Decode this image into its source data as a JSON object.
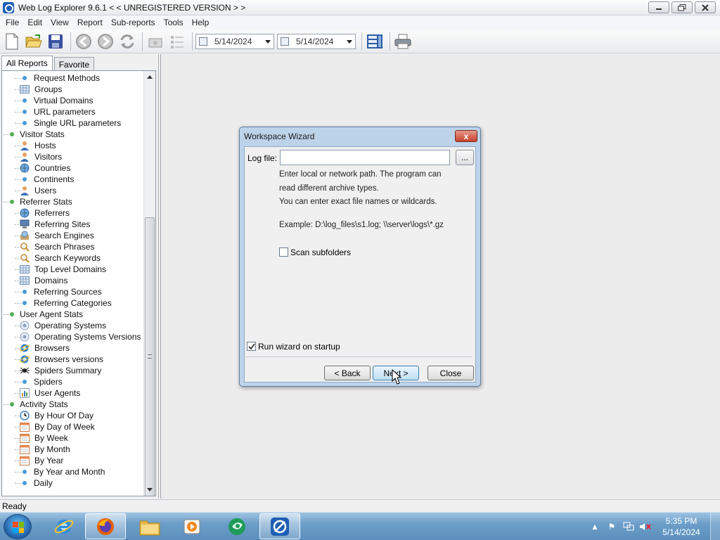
{
  "window": {
    "title": "Web Log Explorer 9.6.1  < < UNREGISTERED VERSION > >",
    "controls": [
      "minimize",
      "restore",
      "close"
    ]
  },
  "menu": [
    "File",
    "Edit",
    "View",
    "Report",
    "Sub-reports",
    "Tools",
    "Help"
  ],
  "toolbar": {
    "date_from": "5/14/2024",
    "date_to": "5/14/2024"
  },
  "left_panel": {
    "tabs": [
      "All Reports",
      "Favorite"
    ],
    "active_tab": "All Reports",
    "tree": [
      {
        "label": "Request Methods",
        "level": 1,
        "icon": "dot"
      },
      {
        "label": "Groups",
        "level": 1,
        "icon": "grid-icon"
      },
      {
        "label": "Virtual Domains",
        "level": 1,
        "icon": "dot"
      },
      {
        "label": "URL parameters",
        "level": 1,
        "icon": "dot"
      },
      {
        "label": "Single URL parameters",
        "level": 1,
        "icon": "dot"
      },
      {
        "label": "Visitor Stats",
        "level": 0,
        "icon": "dot-green"
      },
      {
        "label": "Hosts",
        "level": 1,
        "icon": "person-icon"
      },
      {
        "label": "Visitors",
        "level": 1,
        "icon": "person-icon"
      },
      {
        "label": "Countries",
        "level": 1,
        "icon": "globe-icon"
      },
      {
        "label": "Continents",
        "level": 1,
        "icon": "dot"
      },
      {
        "label": "Users",
        "level": 1,
        "icon": "person-icon"
      },
      {
        "label": "Referrer Stats",
        "level": 0,
        "icon": "dot-green"
      },
      {
        "label": "Referrers",
        "level": 1,
        "icon": "globe-icon"
      },
      {
        "label": "Referring Sites",
        "level": 1,
        "icon": "computer-icon"
      },
      {
        "label": "Search Engines",
        "level": 1,
        "icon": "search-engine-icon"
      },
      {
        "label": "Search Phrases",
        "level": 1,
        "icon": "magnifier-icon"
      },
      {
        "label": "Search Keywords",
        "level": 1,
        "icon": "magnifier-icon"
      },
      {
        "label": "Top Level Domains",
        "level": 1,
        "icon": "grid-icon"
      },
      {
        "label": "Domains",
        "level": 1,
        "icon": "grid-icon"
      },
      {
        "label": "Referring Sources",
        "level": 1,
        "icon": "dot"
      },
      {
        "label": "Referring Categories",
        "level": 1,
        "icon": "dot"
      },
      {
        "label": "User Agent Stats",
        "level": 0,
        "icon": "dot-green"
      },
      {
        "label": "Operating Systems",
        "level": 1,
        "icon": "os-icon"
      },
      {
        "label": "Operating Systems Versions",
        "level": 1,
        "icon": "os-icon"
      },
      {
        "label": "Browsers",
        "level": 1,
        "icon": "ie-icon"
      },
      {
        "label": "Browsers versions",
        "level": 1,
        "icon": "ie-icon"
      },
      {
        "label": "Spiders Summary",
        "level": 1,
        "icon": "spider-icon"
      },
      {
        "label": "Spiders",
        "level": 1,
        "icon": "dot"
      },
      {
        "label": "User Agents",
        "level": 1,
        "icon": "chart-icon"
      },
      {
        "label": "Activity Stats",
        "level": 0,
        "icon": "dot-green"
      },
      {
        "label": "By Hour Of Day",
        "level": 1,
        "icon": "clock-icon"
      },
      {
        "label": "By Day of Week",
        "level": 1,
        "icon": "calendar-icon"
      },
      {
        "label": "By Week",
        "level": 1,
        "icon": "calendar-icon"
      },
      {
        "label": "By Month",
        "level": 1,
        "icon": "calendar-icon"
      },
      {
        "label": "By Year",
        "level": 1,
        "icon": "calendar-icon"
      },
      {
        "label": "By Year and Month",
        "level": 1,
        "icon": "dot"
      },
      {
        "label": "Daily",
        "level": 1,
        "icon": "dot"
      }
    ]
  },
  "dialog": {
    "title": "Workspace Wizard",
    "close_label": "x",
    "logfile_label": "Log file:",
    "logfile_value": "",
    "browse_label": "...",
    "help_line1": "Enter local or network path. The program can",
    "help_line2": "read different archive types.",
    "help_line3": "You can enter exact file names or wildcards.",
    "example": "Example: D:\\log_files\\s1.log; \\\\server\\logs\\*.gz",
    "scan_subfolders_label": "Scan subfolders",
    "scan_subfolders_checked": false,
    "run_wizard_label": "Run wizard on startup",
    "run_wizard_checked": true,
    "back_label": "< Back",
    "next_label": "Next >",
    "close_button_label": "Close"
  },
  "status_bar": {
    "text": "Ready"
  },
  "taskbar": {
    "apps": [
      "internet-explorer-icon",
      "firefox-icon",
      "file-explorer-icon",
      "media-player-icon",
      "app-green-icon",
      "web-log-explorer-icon"
    ],
    "active_app": "web-log-explorer-icon",
    "clock_time": "5:35 PM",
    "clock_date": "5/14/2024"
  },
  "colors": {
    "dialog_frame": "#bcd3ea",
    "close_red": "#c8412c",
    "taskbar": "#6c9ec9",
    "tree_dot": "#4a9ad6",
    "tree_group_dot": "#4caf50"
  }
}
